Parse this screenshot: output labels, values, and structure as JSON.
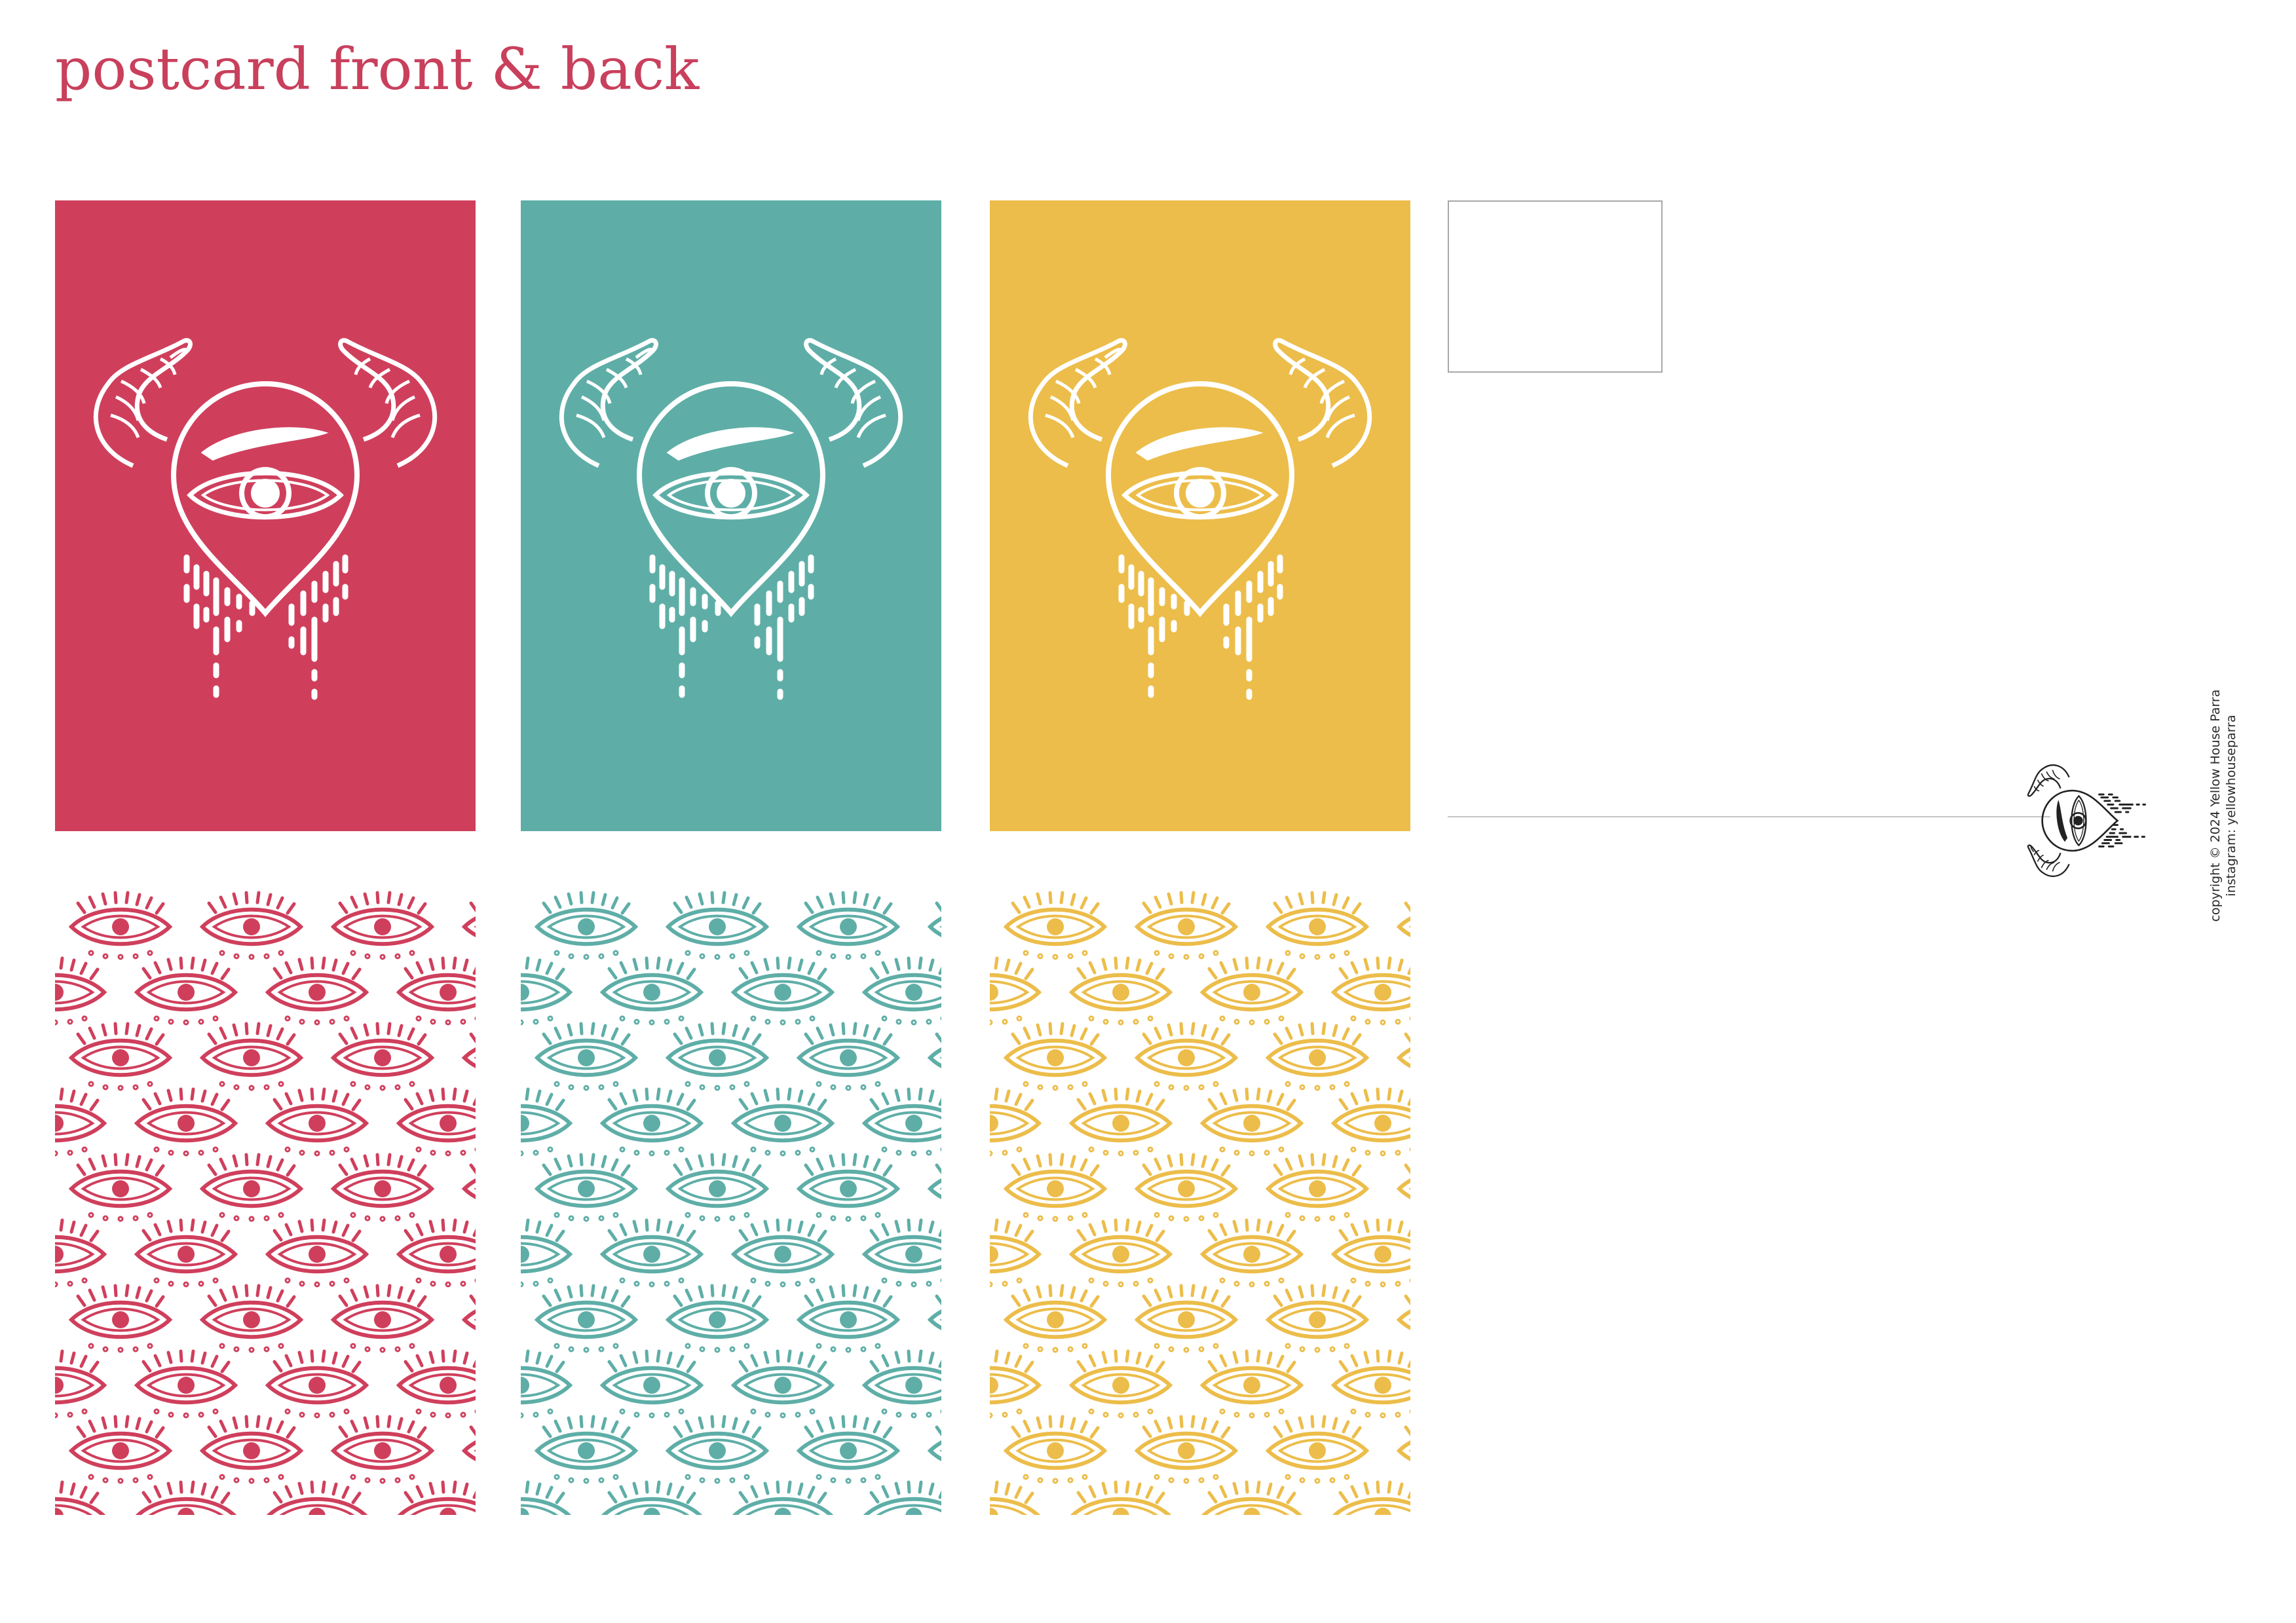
{
  "title": "postcard front & back",
  "colors": {
    "title": "#c8405c",
    "pink": "#cf3f5c",
    "teal": "#5eaea7",
    "yellow": "#ecbd4a"
  },
  "fronts": [
    {
      "name": "pink",
      "icon": "horned-weeping-eye-icon"
    },
    {
      "name": "teal",
      "icon": "horned-weeping-eye-icon"
    },
    {
      "name": "yellow",
      "icon": "horned-weeping-eye-icon"
    }
  ],
  "backs": [
    {
      "name": "pink",
      "icon": "eye-pattern-icon"
    },
    {
      "name": "teal",
      "icon": "eye-pattern-icon"
    },
    {
      "name": "yellow",
      "icon": "eye-pattern-icon"
    }
  ],
  "postcard_back": {
    "copyright": "copyright © 2024 Yellow House Parra",
    "instagram": "instagram: yellowhouseparra"
  }
}
